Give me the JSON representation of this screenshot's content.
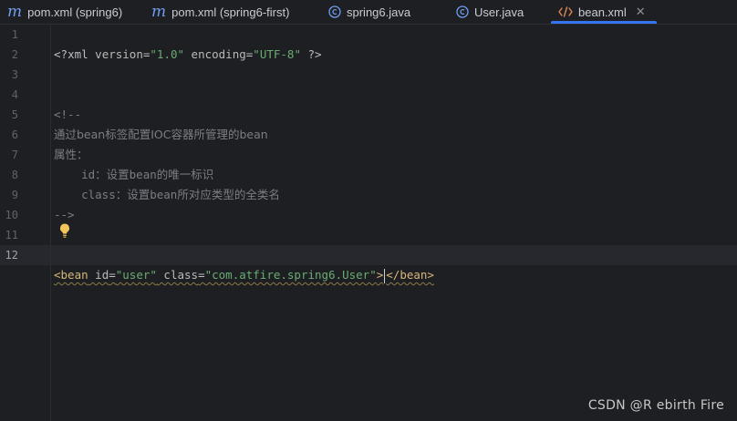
{
  "tabs": [
    {
      "label": "pom.xml (spring6)",
      "icon": "maven-icon",
      "active": false
    },
    {
      "label": "pom.xml (spring6-first)",
      "icon": "maven-icon",
      "active": false
    },
    {
      "label": "spring6.java",
      "icon": "class-icon",
      "active": false
    },
    {
      "label": "User.java",
      "icon": "class-icon",
      "active": false
    },
    {
      "label": "bean.xml",
      "icon": "xml-icon",
      "active": true
    }
  ],
  "colors": {
    "accent": "#3574f0",
    "background": "#1e1f22"
  },
  "editor": {
    "current_line": 12,
    "line_numbers": [
      "1",
      "2",
      "3",
      "4",
      "5",
      "6",
      "7",
      "8",
      "9",
      "10",
      "11",
      "12"
    ],
    "lines": {
      "l1": {
        "p1": "<?",
        "p2": "xml ",
        "p3": "version",
        "p4": "=",
        "p5": "\"1.0\"",
        "p6": " encoding",
        "p7": "=",
        "p8": "\"UTF-8\"",
        "p9": " ?>"
      },
      "l4": "<!--",
      "l5": "通过bean标签配置IOC容器所管理的bean",
      "l6": "属性：",
      "l7": "    id：设置bean的唯一标识",
      "l8": "    class：设置bean所对应类型的全类名",
      "l9": "-->",
      "l12": {
        "p1": "<bean",
        "p2": " id",
        "p3": "=",
        "p4": "\"user\"",
        "p5": " class",
        "p6": "=",
        "p7": "\"com.atfire.spring6.User\"",
        "p8": ">",
        "p9": "</bean>"
      }
    }
  },
  "watermark": "CSDN @R ebirth  Fire"
}
